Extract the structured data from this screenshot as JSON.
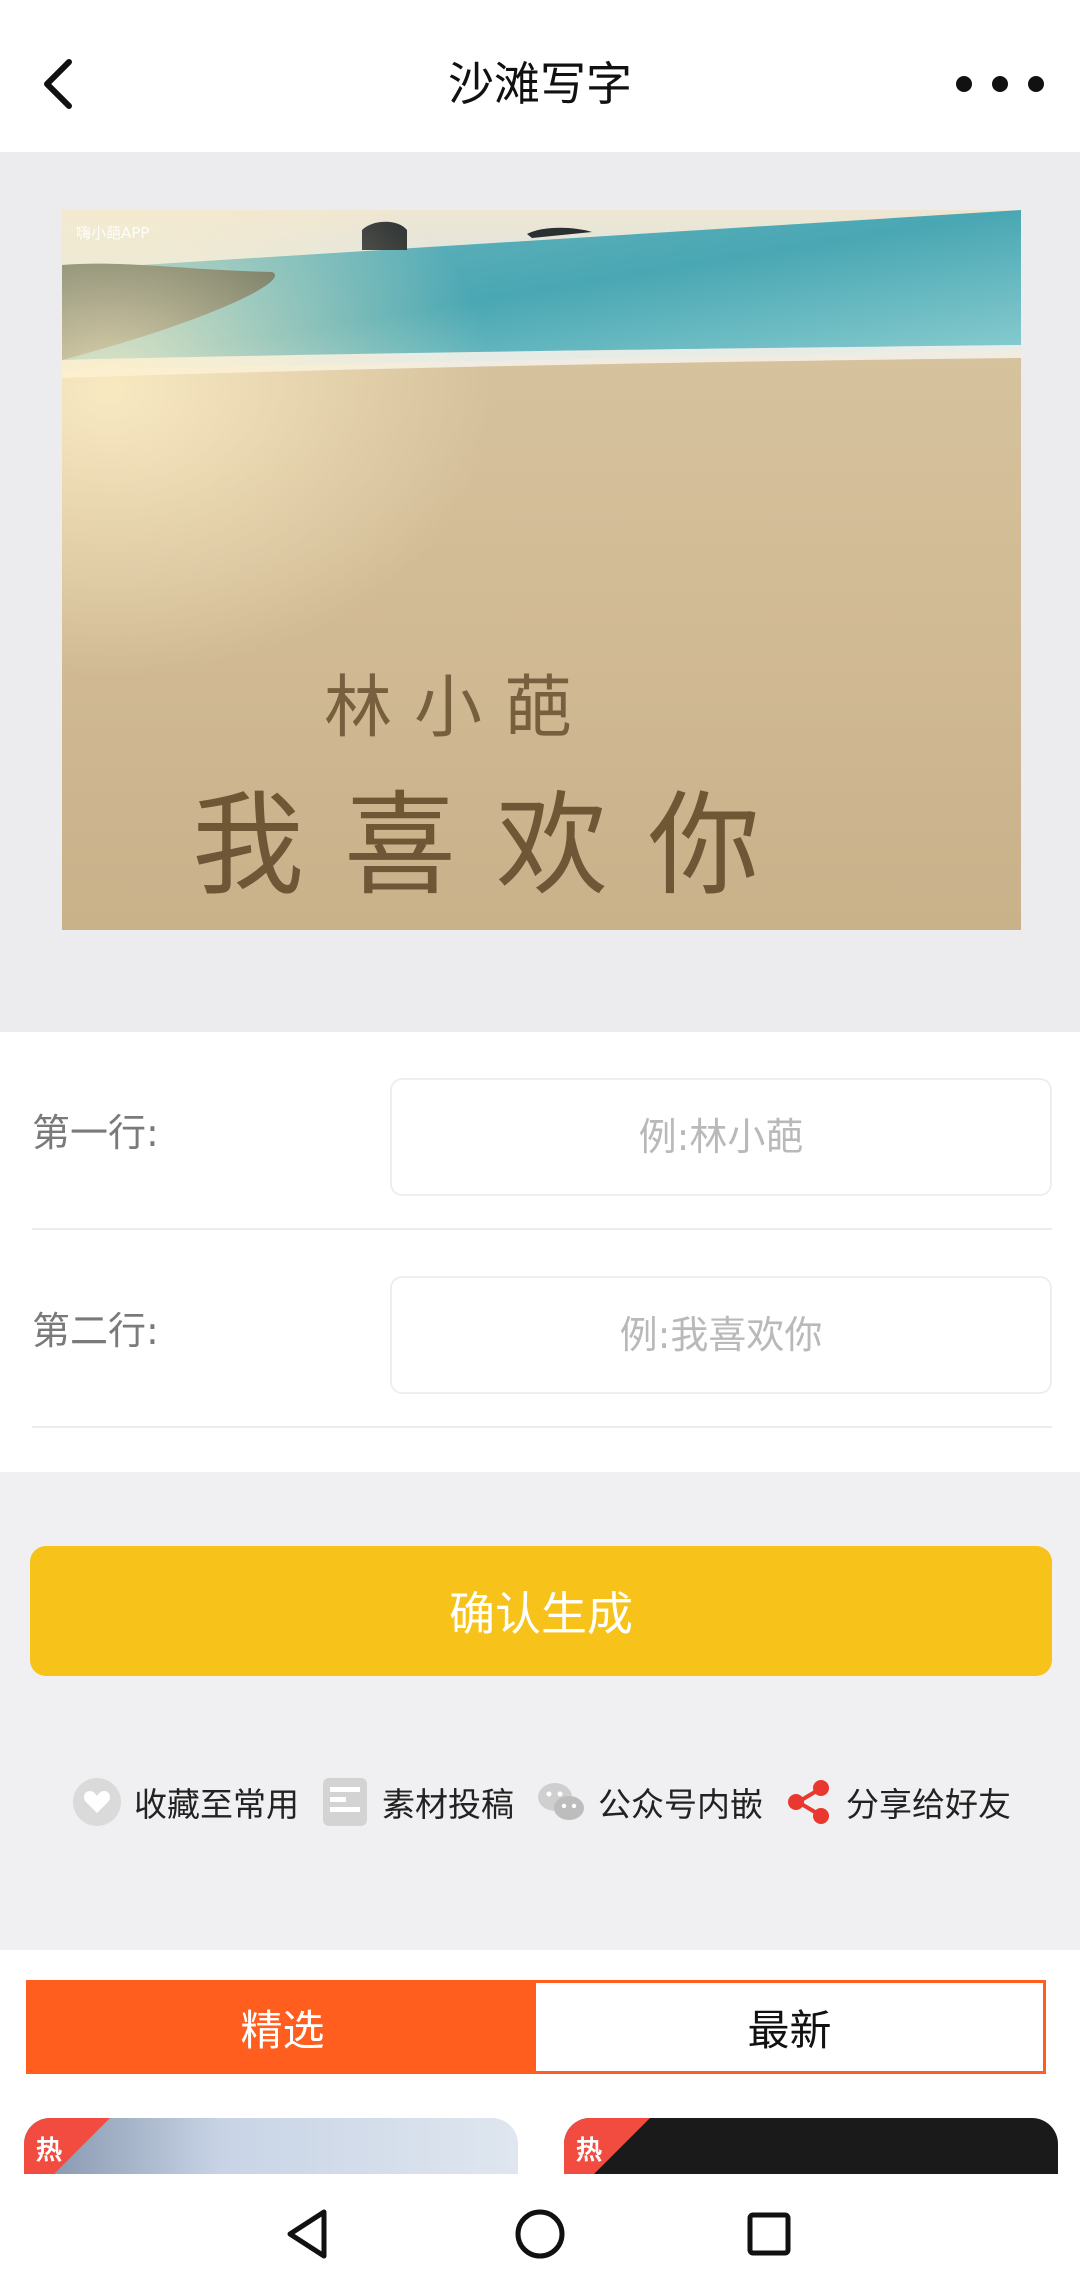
{
  "header": {
    "title": "沙滩写字"
  },
  "preview": {
    "watermark": "嗨小葩APP",
    "line1": "林小葩",
    "line2": "我喜欢你"
  },
  "form": {
    "rows": [
      {
        "label": "第一行:",
        "placeholder": "例:林小葩",
        "value": ""
      },
      {
        "label": "第二行:",
        "placeholder": "例:我喜欢你",
        "value": ""
      }
    ]
  },
  "confirm_label": "确认生成",
  "actions": [
    {
      "label": "收藏至常用",
      "icon": "heart-icon"
    },
    {
      "label": "素材投稿",
      "icon": "document-icon"
    },
    {
      "label": "公众号内嵌",
      "icon": "wechat-icon"
    },
    {
      "label": "分享给好友",
      "icon": "share-icon"
    }
  ],
  "tabs": [
    {
      "label": "精选",
      "active": true
    },
    {
      "label": "最新",
      "active": false
    }
  ],
  "cards": [
    {
      "badge": "热"
    },
    {
      "badge": "热"
    }
  ],
  "colors": {
    "accent_yellow": "#f7c21a",
    "accent_orange": "#ff5e1e",
    "share_red": "#e8382f"
  }
}
